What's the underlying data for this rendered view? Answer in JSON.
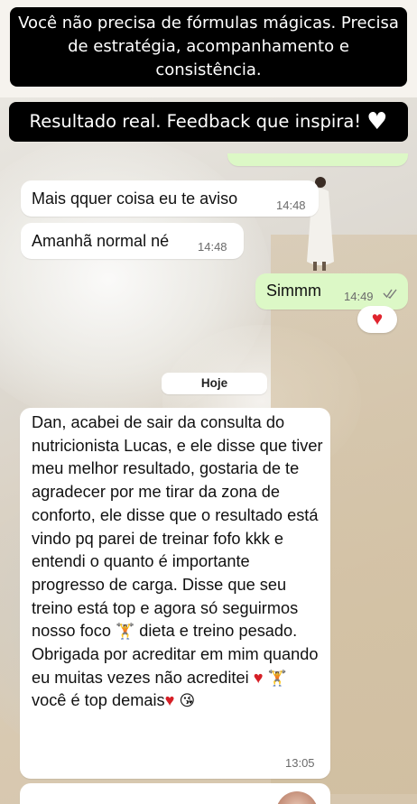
{
  "captions": {
    "top": "Você não precisa de fórmulas mágicas. Precisa de estratégia, acompanhamento e consistência.",
    "middle": "Resultado real. Feedback que inspira!",
    "middle_icon": "white-heart-icon"
  },
  "chat": {
    "messages": [
      {
        "direction": "in",
        "text": "Mais qquer coisa eu te aviso",
        "time": "14:48"
      },
      {
        "direction": "in",
        "text": "Amanhã normal né",
        "time": "14:48"
      },
      {
        "direction": "out",
        "text": "Simmm",
        "time": "14:49",
        "status_icon": "double-check-icon",
        "reaction": "red-heart-icon"
      }
    ],
    "date_divider": "Hoje",
    "long_message": {
      "direction": "in",
      "paragraph_1": "Dan, acabei de sair da consulta do nutricionista Lucas, e ele disse que tiver meu melhor resultado, gostaria de te agradecer por me tirar da zona de conforto, ele disse que o resultado está vindo pq parei de treinar fofo kkk e entendi o quanto é importante progresso de carga. Disse que seu treino está top e agora só seguirmos nosso foco",
      "paragraph_2": "dieta e treino pesado. Obrigada por acreditar em mim quando eu  muitas vezes não acreditei",
      "paragraph_3": "você é top demais",
      "emoji_1": "weightlifter-icon",
      "emoji_2": "red-heart-icon",
      "emoji_3": "weightlifter-icon",
      "emoji_4": "red-heart-icon",
      "emoji_5": "kissing-face-icon",
      "time": "13:05"
    }
  },
  "colors": {
    "incoming_bubble": "#ffffff",
    "outgoing_bubble": "#dcf8c6",
    "caption_background": "#000000",
    "reaction_heart": "#e0242e"
  }
}
